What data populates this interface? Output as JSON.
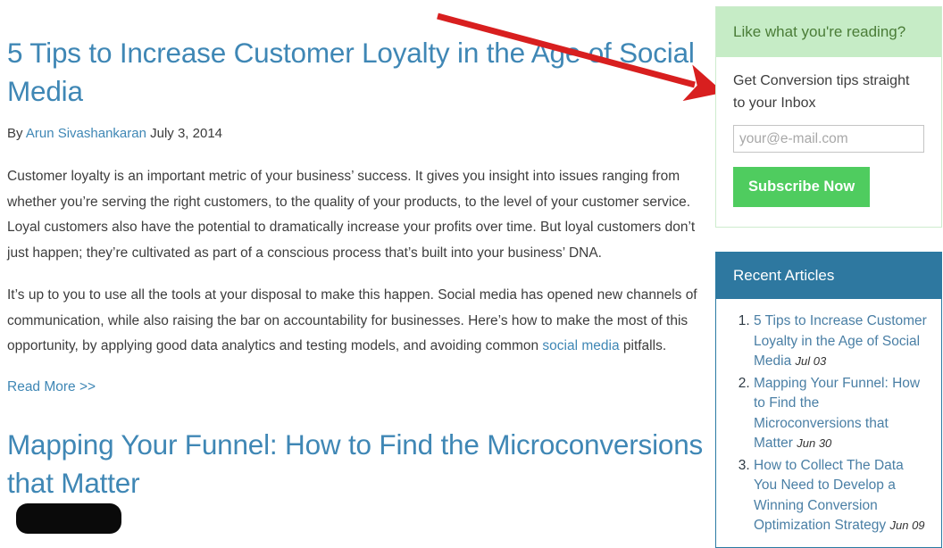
{
  "article": {
    "title": "5 Tips to Increase Customer Loyalty in the Age of Social Media",
    "byline_prefix": "By",
    "author": "Arun Sivashankaran",
    "date": "July 3, 2014",
    "paragraph_1": "Customer loyalty is an important metric of your business’ success. It gives you insight into issues ranging from whether you’re serving the right customers, to the quality of your products, to the level of your customer service. Loyal customers also have the potential to dramatically increase your profits over time. But loyal customers don’t just happen; they’re cultivated as part of a conscious process that’s built into your business’ DNA.",
    "paragraph_2_before_link": "It’s up to you to use all the tools at your disposal to make this happen. Social media has opened new channels of communication, while also raising the bar on accountability for businesses. Here’s how to make the most of this opportunity, by applying good data analytics and testing models, and avoiding common ",
    "paragraph_2_link": "social media",
    "paragraph_2_after_link": " pitfalls.",
    "read_more": "Read More >>"
  },
  "next_article": {
    "title": "Mapping Your Funnel: How to Find the Microconversions that Matter"
  },
  "sidebar": {
    "subscribe": {
      "title": "Like what you're reading?",
      "description": "Get Conversion tips straight to your Inbox",
      "email_placeholder": "your@e-mail.com",
      "email_value": "",
      "button_label": "Subscribe Now",
      "header_bg": "#c6ecc6",
      "button_bg": "#4fcc5f"
    },
    "recent": {
      "title": "Recent Articles",
      "header_bg": "#2e78a0",
      "items": [
        {
          "title": "5 Tips to Increase Customer Loyalty in the Age of Social Media",
          "date": "Jul 03"
        },
        {
          "title": "Mapping Your Funnel: How to Find the Microconversions that Matter",
          "date": "Jun 30"
        },
        {
          "title": "How to Collect The Data You Need to Develop a Winning Conversion Optimization Strategy",
          "date": "Jun 09"
        }
      ]
    }
  },
  "annotations": {
    "arrow_color": "#d81f1f",
    "arrow_name": "red-pointer-arrow"
  },
  "colors": {
    "link_blue": "#3f87b5",
    "body_text": "#3d3d3d"
  }
}
